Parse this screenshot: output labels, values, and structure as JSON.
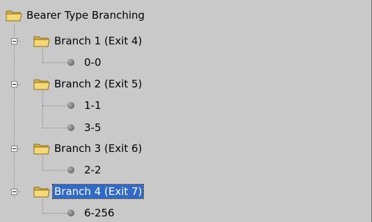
{
  "tree": {
    "root": {
      "label": "Bearer Type Branching",
      "icon": "folder-open-icon"
    },
    "branches": [
      {
        "label": "Branch 1 (Exit 4)",
        "expanded": true,
        "selected": false,
        "children": [
          "0-0"
        ]
      },
      {
        "label": "Branch 2 (Exit 5)",
        "expanded": true,
        "selected": false,
        "children": [
          "1-1",
          "3-5"
        ]
      },
      {
        "label": "Branch 3 (Exit 6)",
        "expanded": true,
        "selected": false,
        "children": [
          "2-2"
        ]
      },
      {
        "label": "Branch 4 (Exit 7)",
        "expanded": true,
        "selected": true,
        "children": [
          "6-256"
        ]
      }
    ]
  },
  "colors": {
    "background": "#c9c9c9",
    "selection": "#3169c6",
    "selection_text": "#ffffff"
  }
}
